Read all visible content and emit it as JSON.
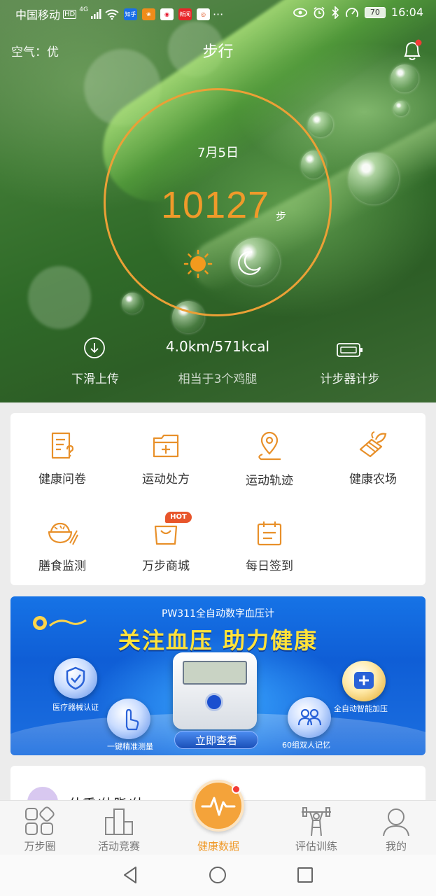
{
  "status_bar": {
    "carrier": "中国移动",
    "hd": "HD",
    "network": "4G",
    "notification_icons": [
      "zhihu-icon",
      "app-icon",
      "sina-icon",
      "news-icon",
      "app-icon"
    ],
    "more": "···",
    "battery": "70",
    "time": "16:04"
  },
  "header": {
    "air_quality": "空气：优",
    "title": "步行"
  },
  "summary": {
    "date": "7月5日",
    "steps": "10127",
    "steps_unit": "步",
    "distance_calories": "4.0km/571kcal",
    "equivalent": "相当于3个鸡腿",
    "upload_label": "下滑上传",
    "pedometer_label": "计步器计步",
    "accent_color": "#f09a2a"
  },
  "features": [
    {
      "label": "健康问卷",
      "icon": "questionnaire-icon"
    },
    {
      "label": "运动处方",
      "icon": "prescription-icon"
    },
    {
      "label": "运动轨迹",
      "icon": "location-pin-icon"
    },
    {
      "label": "健康农场",
      "icon": "farm-icon"
    },
    {
      "label": "膳食监测",
      "icon": "bowl-icon"
    },
    {
      "label": "万步商城",
      "icon": "shopping-bag-icon",
      "badge": "HOT"
    },
    {
      "label": "每日签到",
      "icon": "calendar-icon"
    }
  ],
  "banner": {
    "subtitle": "PW311全自动数字血压计",
    "headline": "关注血压   助力健康",
    "features": [
      "医疗器械认证",
      "一键精准测量",
      "全自动智能加压",
      "60组双人记忆"
    ],
    "cta": "立即查看"
  },
  "peek": {
    "text": "体重/体脂/体..."
  },
  "tabs": [
    {
      "label": "万步圈",
      "icon": "community-icon"
    },
    {
      "label": "活动竞赛",
      "icon": "competition-icon"
    },
    {
      "label": "健康数据",
      "icon": "pulse-icon",
      "active": true
    },
    {
      "label": "评估训练",
      "icon": "weightlifting-icon"
    },
    {
      "label": "我的",
      "icon": "profile-icon"
    }
  ]
}
